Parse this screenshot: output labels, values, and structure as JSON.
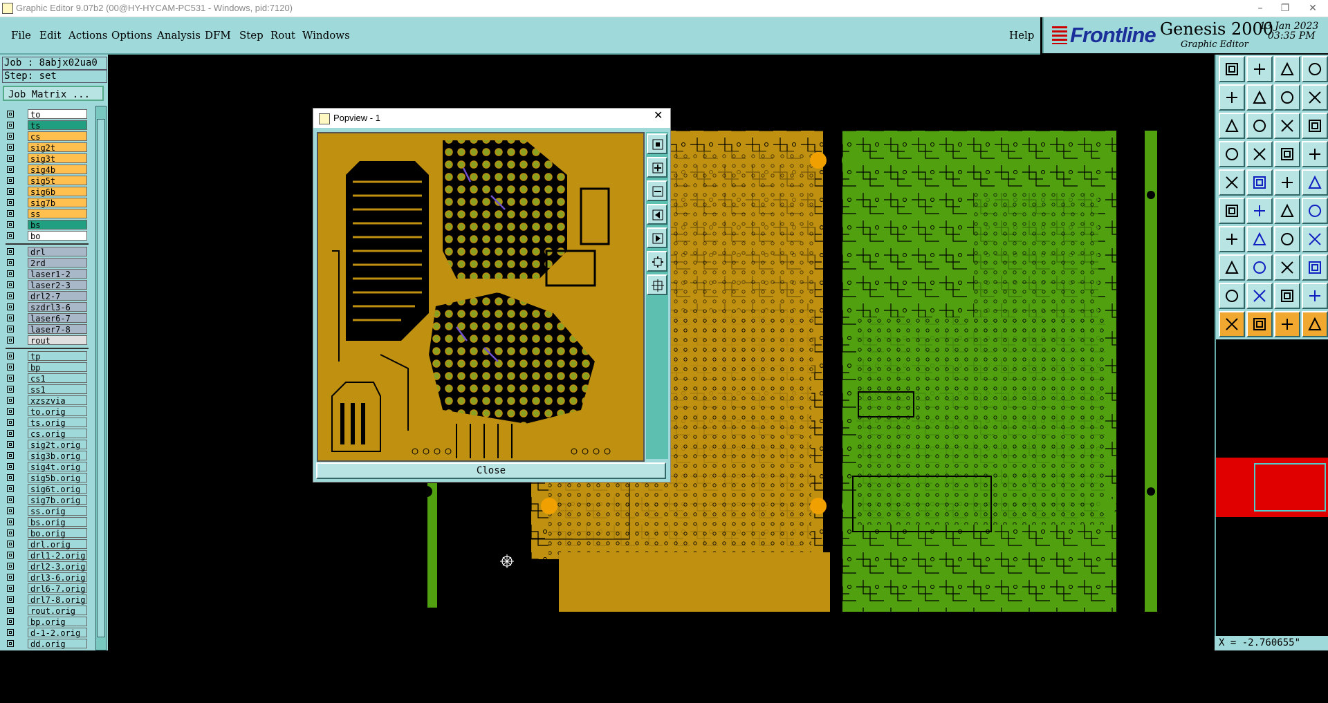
{
  "window": {
    "title": "Graphic Editor 9.07b2 (00@HY-HYCAM-PC531 - Windows, pid:7120)",
    "min": "–",
    "restore": "❐",
    "close": "✕"
  },
  "menu": {
    "items": [
      "File",
      "Edit",
      "Actions",
      "Options",
      "Analysis",
      "DFM",
      "Step",
      "Rout",
      "Windows"
    ],
    "help": "Help"
  },
  "brand": {
    "logo": "Frontline",
    "product": "Genesis 2000",
    "subtitle": "Graphic Editor",
    "date": "13 Jan 2023",
    "time": "03:35 PM"
  },
  "job": {
    "job_line": "Job : 8abjx02ua0",
    "step_line": "Step: set",
    "matrix_button": "Job Matrix ..."
  },
  "layers_group1": [
    {
      "name": "to",
      "color": "#ffffff"
    },
    {
      "name": "ts",
      "color": "#20a080"
    },
    {
      "name": "cs",
      "color": "#ffc050"
    },
    {
      "name": "sig2t",
      "color": "#ffc050"
    },
    {
      "name": "sig3t",
      "color": "#ffc050"
    },
    {
      "name": "sig4b",
      "color": "#ffc050"
    },
    {
      "name": "sig5t",
      "color": "#ffc050"
    },
    {
      "name": "sig6b",
      "color": "#ffc050"
    },
    {
      "name": "sig7b",
      "color": "#ffc050"
    },
    {
      "name": "ss",
      "color": "#ffc050"
    },
    {
      "name": "bs",
      "color": "#20a080"
    },
    {
      "name": "bo",
      "color": "#ffffff"
    }
  ],
  "layers_group2": [
    {
      "name": "drl",
      "color": "#a8b8c8"
    },
    {
      "name": "2rd",
      "color": "#a8b8c8"
    },
    {
      "name": "laser1-2",
      "color": "#a8b8c8"
    },
    {
      "name": "laser2-3",
      "color": "#a8b8c8"
    },
    {
      "name": "drl2-7",
      "color": "#a8b8c8"
    },
    {
      "name": "szdrl3-6",
      "color": "#a8b8c8"
    },
    {
      "name": "laser6-7",
      "color": "#a8b8c8"
    },
    {
      "name": "laser7-8",
      "color": "#a8b8c8"
    },
    {
      "name": "rout",
      "color": "#e0e0e0"
    }
  ],
  "layers_group3": [
    {
      "name": "tp",
      "color": "#a0d9d9"
    },
    {
      "name": "bp",
      "color": "#a0d9d9"
    },
    {
      "name": "cs1",
      "color": "#a0d9d9"
    },
    {
      "name": "ss1",
      "color": "#a0d9d9"
    },
    {
      "name": "xzszvia",
      "color": "#a0d9d9"
    },
    {
      "name": "to.orig",
      "color": "#a0d9d9"
    },
    {
      "name": "ts.orig",
      "color": "#a0d9d9"
    },
    {
      "name": "cs.orig",
      "color": "#a0d9d9"
    },
    {
      "name": "sig2t.orig",
      "color": "#a0d9d9"
    },
    {
      "name": "sig3b.orig",
      "color": "#a0d9d9"
    },
    {
      "name": "sig4t.orig",
      "color": "#a0d9d9"
    },
    {
      "name": "sig5b.orig",
      "color": "#a0d9d9"
    },
    {
      "name": "sig6t.orig",
      "color": "#a0d9d9"
    },
    {
      "name": "sig7b.orig",
      "color": "#a0d9d9"
    },
    {
      "name": "ss.orig",
      "color": "#a0d9d9"
    },
    {
      "name": "bs.orig",
      "color": "#a0d9d9"
    },
    {
      "name": "bo.orig",
      "color": "#a0d9d9"
    },
    {
      "name": "drl.orig",
      "color": "#a0d9d9"
    },
    {
      "name": "drl1-2.orig",
      "color": "#a0d9d9"
    },
    {
      "name": "drl2-3.orig",
      "color": "#a0d9d9"
    },
    {
      "name": "drl3-6.orig",
      "color": "#a0d9d9"
    },
    {
      "name": "drl6-7.orig",
      "color": "#a0d9d9"
    },
    {
      "name": "drl7-8.orig",
      "color": "#a0d9d9"
    },
    {
      "name": "rout.orig",
      "color": "#a0d9d9"
    },
    {
      "name": "bp.orig",
      "color": "#a0d9d9"
    },
    {
      "name": "d-1-2.orig",
      "color": "#a0d9d9"
    },
    {
      "name": "dd.orig",
      "color": "#a0d9d9"
    }
  ],
  "popview": {
    "title": "Popview - 1",
    "close_button": "Close"
  },
  "coords": {
    "x": "X = -2.760655\""
  },
  "colors": {
    "panel": "#a0d9d9",
    "layer_signal": "#ffc050",
    "pcb_gold": "#c09010",
    "pcb_green": "#50a010",
    "overview_bg": "#e00000"
  }
}
